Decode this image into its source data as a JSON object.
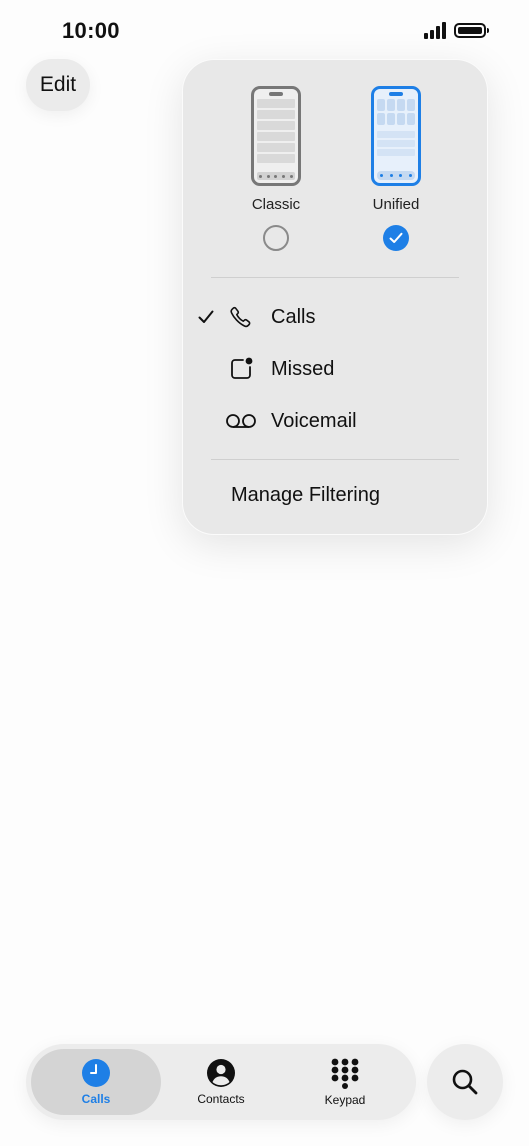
{
  "status_bar": {
    "time": "10:00"
  },
  "header": {
    "edit_label": "Edit"
  },
  "layout_picker": {
    "options": [
      {
        "label": "Classic",
        "selected": false
      },
      {
        "label": "Unified",
        "selected": true
      }
    ]
  },
  "filter_menu": {
    "items": [
      {
        "label": "Calls",
        "icon": "phone-icon",
        "checked": true
      },
      {
        "label": "Missed",
        "icon": "missed-call-icon",
        "checked": false
      },
      {
        "label": "Voicemail",
        "icon": "voicemail-icon",
        "checked": false
      }
    ],
    "manage_label": "Manage Filtering"
  },
  "tab_bar": {
    "tabs": [
      {
        "label": "Calls",
        "icon": "clock-icon",
        "active": true
      },
      {
        "label": "Contacts",
        "icon": "person-circle-icon",
        "active": false
      },
      {
        "label": "Keypad",
        "icon": "keypad-icon",
        "active": false
      }
    ],
    "search_icon": "search-icon"
  },
  "colors": {
    "accent": "#1e7fe6",
    "popover_background": "#e8e8e8",
    "tab_bar_background": "#ececec"
  }
}
